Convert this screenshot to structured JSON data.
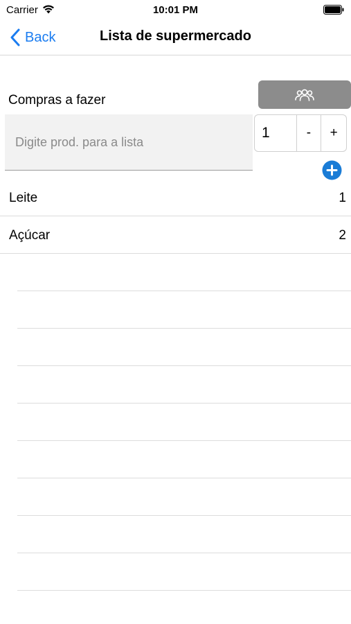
{
  "status_bar": {
    "carrier": "Carrier",
    "time": "10:01 PM"
  },
  "nav": {
    "back_label": "Back",
    "title": "Lista de supermercado"
  },
  "section": {
    "label": "Compras a fazer"
  },
  "share_button": {
    "icon": "people-group-icon"
  },
  "input": {
    "placeholder": "Digite prod. para a lista",
    "value": ""
  },
  "stepper": {
    "value": "1",
    "minus_label": "-",
    "plus_label": "+"
  },
  "add_button": {
    "icon": "plus-circle-icon"
  },
  "items": [
    {
      "name": "Leite",
      "qty": "1"
    },
    {
      "name": "Açúcar",
      "qty": "2"
    }
  ],
  "colors": {
    "accent": "#1a7cf0",
    "share_button_bg": "#8c8c8c",
    "add_button": "#1a7cd6"
  }
}
